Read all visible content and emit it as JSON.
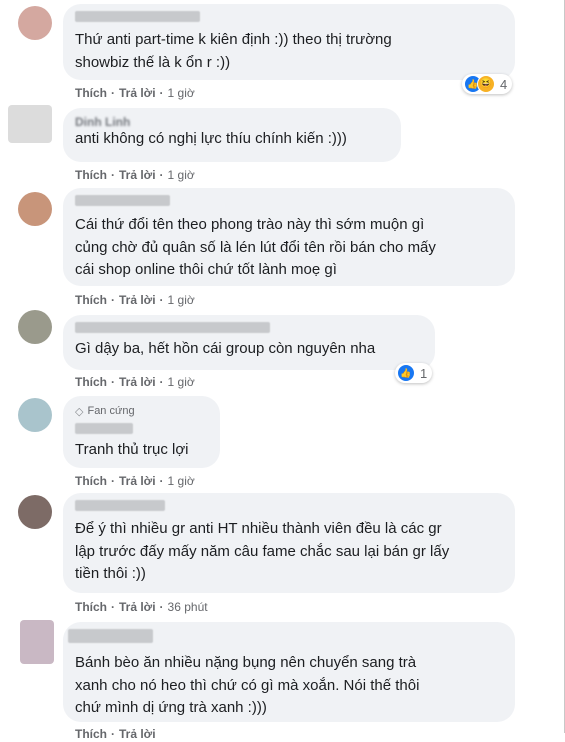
{
  "colors": {
    "bubble": "#f0f2f5",
    "text": "#1c1e21",
    "meta": "#65676b",
    "like": "#1877f2",
    "haha": "#f7b125"
  },
  "labels": {
    "like": "Thích",
    "reply": "Trả lời"
  },
  "comments": [
    {
      "text": "Thứ anti part-time k kiên định :)) theo thị trường\nshowbiz thế là k ổn r :))",
      "time": "1 giờ",
      "reactions": {
        "icons": [
          "like-icon",
          "haha-icon"
        ],
        "count": "4"
      }
    },
    {
      "name_partial": "Dinh Linh",
      "text": "anti không có nghị lực thíu chính kiến :)))",
      "time": "1 giờ"
    },
    {
      "text": "Cái thứ đổi tên theo phong trào này thì sớm muộn gì\ncủng chờ đủ quân số là lén lút đổi tên rồi bán cho mấy\ncái shop online thôi chứ tốt lành moẹ gì",
      "time": "1 giờ"
    },
    {
      "text": "Gì dậy ba, hết hồn cái group còn nguyên nha",
      "time": "1 giờ",
      "reactions": {
        "icons": [
          "like-icon"
        ],
        "count": "1"
      }
    },
    {
      "badge": "Fan cứng",
      "text": "Tranh thủ trục lợi",
      "time": "1 giờ"
    },
    {
      "text": "Để ý thì nhiều gr anti HT nhiều thành viên đều là các gr\nlập trước đấy mấy năm câu fame chắc sau lại bán gr lấy\ntiền thôi :))",
      "time": "36 phút"
    },
    {
      "text": "Bánh bèo ăn nhiều nặng bụng nên chuyển sang trà\nxanh cho nó heo thì chứ có gì mà xoắn. Nói thế thôi\nchứ mình dị ứng trà xanh :)))",
      "time": ""
    }
  ]
}
